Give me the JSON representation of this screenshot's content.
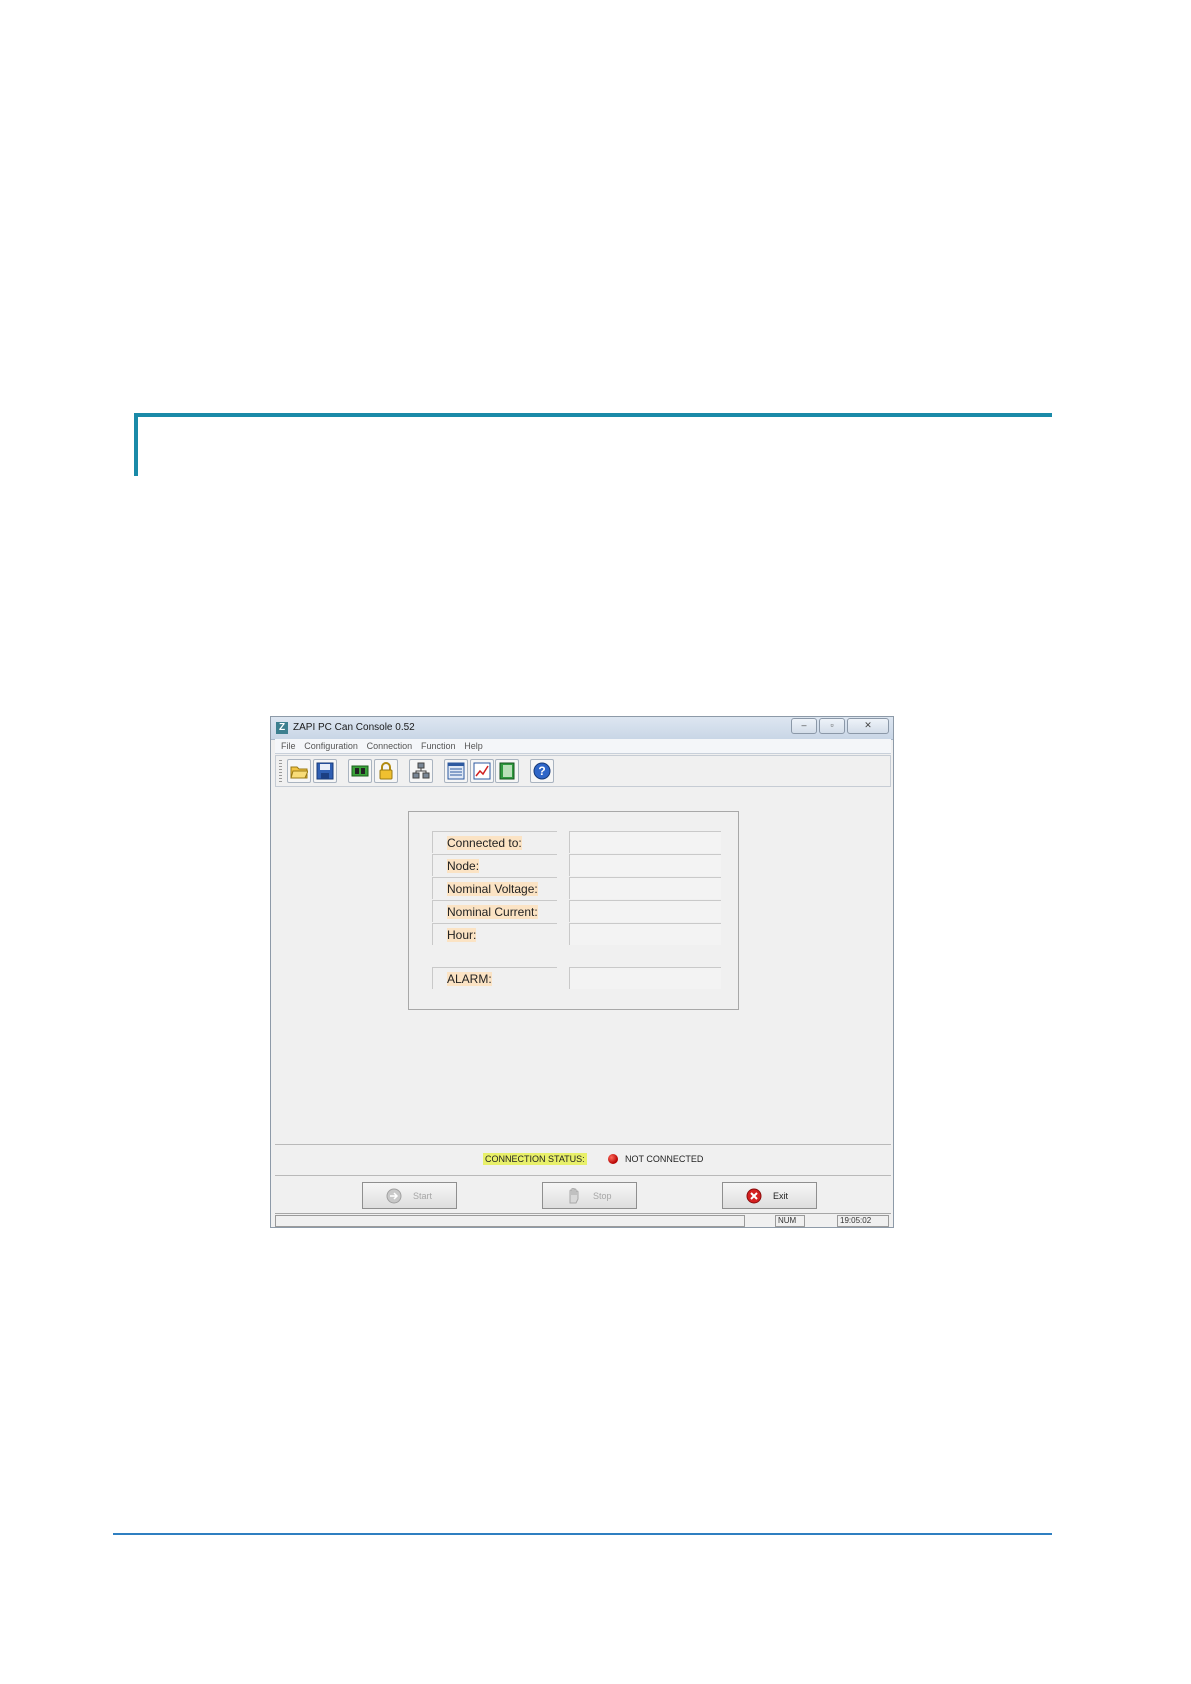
{
  "window": {
    "title": "ZAPI PC Can Console 0.52",
    "app_icon_letter": "Z",
    "controls": [
      "–",
      "▫",
      "✕"
    ]
  },
  "menu": [
    "File",
    "Configuration",
    "Connection",
    "Function",
    "Help"
  ],
  "toolbar": {
    "icons": [
      "open-folder-icon",
      "save-disk-icon",
      "circuit-board-icon",
      "lock-icon",
      "network-icon",
      "list-window-icon",
      "chart-icon",
      "book-icon",
      "help-icon"
    ]
  },
  "info": {
    "rows": [
      {
        "label": "Connected to:",
        "value": ""
      },
      {
        "label": "Node:",
        "value": ""
      },
      {
        "label": "Nominal Voltage:",
        "value": ""
      },
      {
        "label": "Nominal Current:",
        "value": ""
      },
      {
        "label": "Hour:",
        "value": ""
      },
      {
        "label": "ALARM:",
        "value": ""
      }
    ]
  },
  "connection": {
    "status_label": "CONNECTION STATUS:",
    "status_value": "NOT CONNECTED",
    "led_color": "#c00000"
  },
  "buttons": {
    "start": "Start",
    "stop": "Stop",
    "exit": "Exit"
  },
  "statusbar": {
    "num": "NUM",
    "time": "19:05:02"
  },
  "colors": {
    "accent_rule": "#1a8aa8",
    "label_highlight": "#fbe3c4",
    "status_highlight": "#e8f06a"
  }
}
